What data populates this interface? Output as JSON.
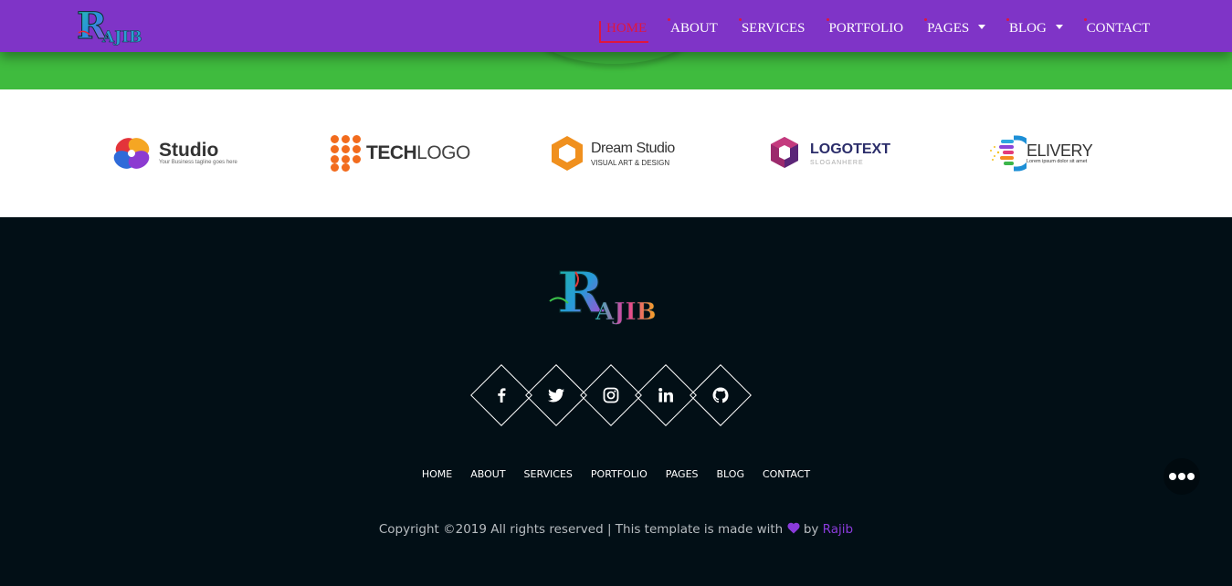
{
  "header": {
    "logo_text": "Rajib",
    "nav": [
      {
        "label": "HOME",
        "active": true,
        "dropdown": false
      },
      {
        "label": "ABOUT",
        "active": false,
        "dropdown": false
      },
      {
        "label": "SERVICES",
        "active": false,
        "dropdown": false
      },
      {
        "label": "PORTFOLIO",
        "active": false,
        "dropdown": false
      },
      {
        "label": "PAGES",
        "active": false,
        "dropdown": true
      },
      {
        "label": "BLOG",
        "active": false,
        "dropdown": true
      },
      {
        "label": "CONTACT",
        "active": false,
        "dropdown": false
      }
    ]
  },
  "brands": {
    "studio": {
      "name": "Studio",
      "tagline": "Your Business tagline goes here"
    },
    "techlogo": {
      "name_bold": "TECH",
      "name_light": "LOGO"
    },
    "dream": {
      "name": "Dream Studio",
      "tagline": "VISUAL ART & DESIGN"
    },
    "logotext": {
      "name": "LOGOTEXT",
      "tagline": "SLOGANHERE"
    },
    "delivery": {
      "initial": "D",
      "name": "ELIVERY",
      "tagline": "Lorem ipsum dolor sit amet"
    }
  },
  "footer": {
    "logo_text": "Rajib",
    "socials": [
      "facebook-icon",
      "twitter-icon",
      "instagram-icon",
      "linkedin-icon",
      "github-icon"
    ],
    "nav": [
      "HOME",
      "ABOUT",
      "SERVICES",
      "PORTFOLIO",
      "PAGES",
      "BLOG",
      "CONTACT"
    ],
    "copyright_before": "Copyright ©2019 All rights reserved | This template is made with",
    "copyright_by": "by",
    "copyright_author": "Rajib"
  },
  "colors": {
    "navbar": "#7f34c7",
    "accent_red": "#e0163d",
    "green_band": "#3fbb3e",
    "footer_bg": "#020f16",
    "author_link": "#8a3bdb"
  }
}
